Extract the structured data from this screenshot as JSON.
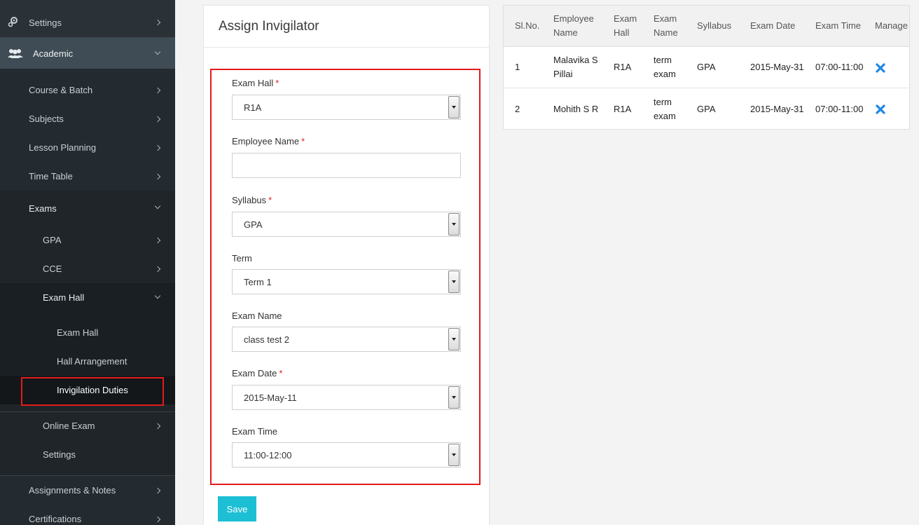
{
  "sidebar": {
    "items": [
      {
        "label": "Settings"
      },
      {
        "label": "Academic"
      },
      {
        "label": "Course & Batch"
      },
      {
        "label": "Subjects"
      },
      {
        "label": "Lesson Planning"
      },
      {
        "label": "Time Table"
      },
      {
        "label": "Exams"
      },
      {
        "label": "GPA"
      },
      {
        "label": "CCE"
      },
      {
        "label": "Exam Hall"
      },
      {
        "label": "Exam Hall"
      },
      {
        "label": "Hall Arrangement"
      },
      {
        "label": "Invigilation Duties"
      },
      {
        "label": "Online Exam"
      },
      {
        "label": "Settings"
      },
      {
        "label": "Assignments & Notes"
      },
      {
        "label": "Certifications"
      }
    ]
  },
  "form": {
    "title": "Assign Invigilator",
    "exam_hall_label": "Exam Hall",
    "exam_hall_value": "R1A",
    "employee_label": "Employee Name",
    "employee_value": "",
    "syllabus_label": "Syllabus",
    "syllabus_value": "GPA",
    "term_label": "Term",
    "term_value": "Term 1",
    "exam_name_label": "Exam Name",
    "exam_name_value": "class test 2",
    "exam_date_label": "Exam Date",
    "exam_date_value": "2015-May-11",
    "exam_time_label": "Exam Time",
    "exam_time_value": "11:00-12:00",
    "required_mark": "*",
    "save_label": "Save"
  },
  "table": {
    "headers": [
      "Sl.No.",
      "Employee\nName",
      "Exam\nHall",
      "Exam\nName",
      "Syllabus",
      "Exam Date",
      "Exam Time",
      "Manage"
    ],
    "rows": [
      [
        "1",
        "Malavika S\nPillai",
        "R1A",
        "term\nexam",
        "GPA",
        "2015-May-31",
        "07:00-11:00"
      ],
      [
        "2",
        "Mohith S R",
        "R1A",
        "term\nexam",
        "GPA",
        "2015-May-31",
        "07:00-11:00"
      ]
    ]
  },
  "colors": {
    "sidebar_bg": "#2b3237",
    "highlight_border": "#e41a1a",
    "save_button": "#1dbfd4",
    "delete_icon": "#1e88e5"
  }
}
